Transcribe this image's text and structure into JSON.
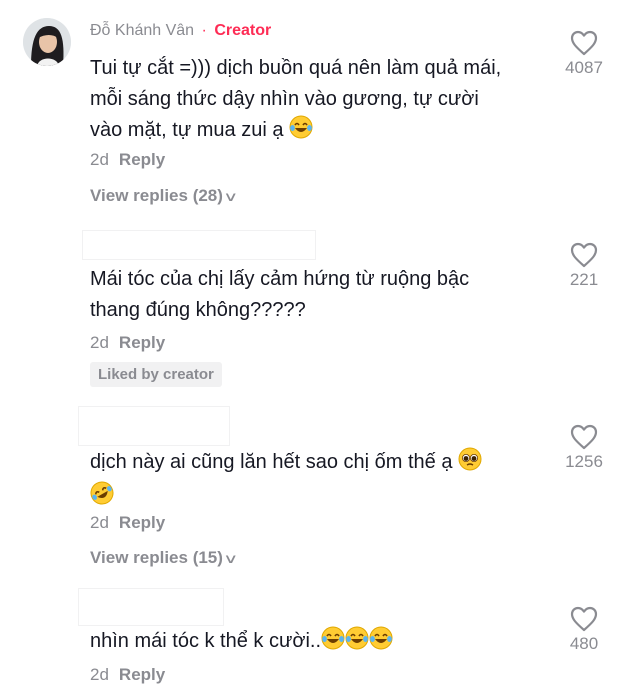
{
  "comments": [
    {
      "author": "Đỗ Khánh Vân",
      "badge": "Creator",
      "separator": "·",
      "lines": [
        "Tui tự cắt =))) dịch buồn quá nên làm quả mái,",
        "mỗi sáng thức dậy nhìn vào gương, tự cười",
        "vào mặt, tự mua zui ạ"
      ],
      "time": "2d",
      "reply": "Reply",
      "view_replies": "View replies (28)",
      "likes": "4087"
    },
    {
      "lines": [
        "Mái tóc của chị lấy cảm hứng từ ruộng bậc",
        "thang đúng không?????"
      ],
      "time": "2d",
      "reply": "Reply",
      "liked_by": "Liked by creator",
      "likes": "221"
    },
    {
      "lines": [
        "dịch này ai cũng lăn hết sao chị ốm thế ạ"
      ],
      "time": "2d",
      "reply": "Reply",
      "view_replies": "View replies (15)",
      "likes": "1256"
    },
    {
      "lines": [
        "nhìn mái tóc k thể k cười.."
      ],
      "time": "2d",
      "reply": "Reply",
      "likes": "480"
    }
  ],
  "icons": {
    "like": "heart-outline-icon",
    "expand": "chevron-down-icon",
    "laugh": "tears-of-joy-emoji",
    "rofl": "rolling-laughing-emoji",
    "pleading": "pleading-face-emoji"
  },
  "colors": {
    "creator": "#fe2c55",
    "secondary_text": "#8a8b91",
    "primary_text": "#161823"
  }
}
